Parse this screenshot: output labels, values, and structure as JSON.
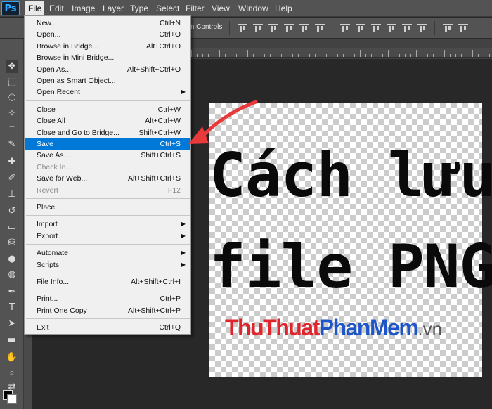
{
  "app": {
    "logo": "Ps"
  },
  "menubar": {
    "items": [
      "File",
      "Edit",
      "Image",
      "Layer",
      "Type",
      "Select",
      "Filter",
      "View",
      "Window",
      "Help"
    ],
    "active": "File"
  },
  "optionsbar": {
    "label": "m Controls"
  },
  "tools": {
    "icons": [
      "move-icon",
      "marquee-icon",
      "lasso-icon",
      "magic-wand-icon",
      "crop-icon",
      "eyedropper-icon",
      "healing-brush-icon",
      "brush-icon",
      "clone-stamp-icon",
      "history-brush-icon",
      "eraser-icon",
      "paint-bucket-icon",
      "blur-icon",
      "dodge-icon",
      "pen-icon",
      "type-icon",
      "path-selection-icon",
      "rectangle-icon",
      "hand-icon",
      "zoom-icon",
      "swap-colors-icon",
      "color-swatches-icon"
    ]
  },
  "file_menu": {
    "groups": [
      [
        {
          "label": "New...",
          "shortcut": "Ctrl+N"
        },
        {
          "label": "Open...",
          "shortcut": "Ctrl+O"
        },
        {
          "label": "Browse in Bridge...",
          "shortcut": "Alt+Ctrl+O"
        },
        {
          "label": "Browse in Mini Bridge...",
          "shortcut": ""
        },
        {
          "label": "Open As...",
          "shortcut": "Alt+Shift+Ctrl+O"
        },
        {
          "label": "Open as Smart Object...",
          "shortcut": ""
        },
        {
          "label": "Open Recent",
          "shortcut": "",
          "submenu": true
        }
      ],
      [
        {
          "label": "Close",
          "shortcut": "Ctrl+W"
        },
        {
          "label": "Close All",
          "shortcut": "Alt+Ctrl+W"
        },
        {
          "label": "Close and Go to Bridge...",
          "shortcut": "Shift+Ctrl+W"
        },
        {
          "label": "Save",
          "shortcut": "Ctrl+S",
          "highlighted": true
        },
        {
          "label": "Save As...",
          "shortcut": "Shift+Ctrl+S"
        },
        {
          "label": "Check In...",
          "shortcut": "",
          "disabled": true
        },
        {
          "label": "Save for Web...",
          "shortcut": "Alt+Shift+Ctrl+S"
        },
        {
          "label": "Revert",
          "shortcut": "F12",
          "disabled": true
        }
      ],
      [
        {
          "label": "Place...",
          "shortcut": ""
        }
      ],
      [
        {
          "label": "Import",
          "shortcut": "",
          "submenu": true
        },
        {
          "label": "Export",
          "shortcut": "",
          "submenu": true
        }
      ],
      [
        {
          "label": "Automate",
          "shortcut": "",
          "submenu": true
        },
        {
          "label": "Scripts",
          "shortcut": "",
          "submenu": true
        }
      ],
      [
        {
          "label": "File Info...",
          "shortcut": "Alt+Shift+Ctrl+I"
        }
      ],
      [
        {
          "label": "Print...",
          "shortcut": "Ctrl+P"
        },
        {
          "label": "Print One Copy",
          "shortcut": "Alt+Shift+Ctrl+P"
        }
      ],
      [
        {
          "label": "Exit",
          "shortcut": "Ctrl+Q"
        }
      ]
    ]
  },
  "canvas": {
    "line1": "Cách lưu",
    "line2": "file PNG",
    "watermark_a": "ThuThuat",
    "watermark_b": "PhanMem",
    "watermark_c": ".vn"
  },
  "colors": {
    "highlight": "#0078d7",
    "annotation_arrow": "#e8393b",
    "watermark_red": "#e0242b",
    "watermark_blue": "#1e56c9"
  }
}
